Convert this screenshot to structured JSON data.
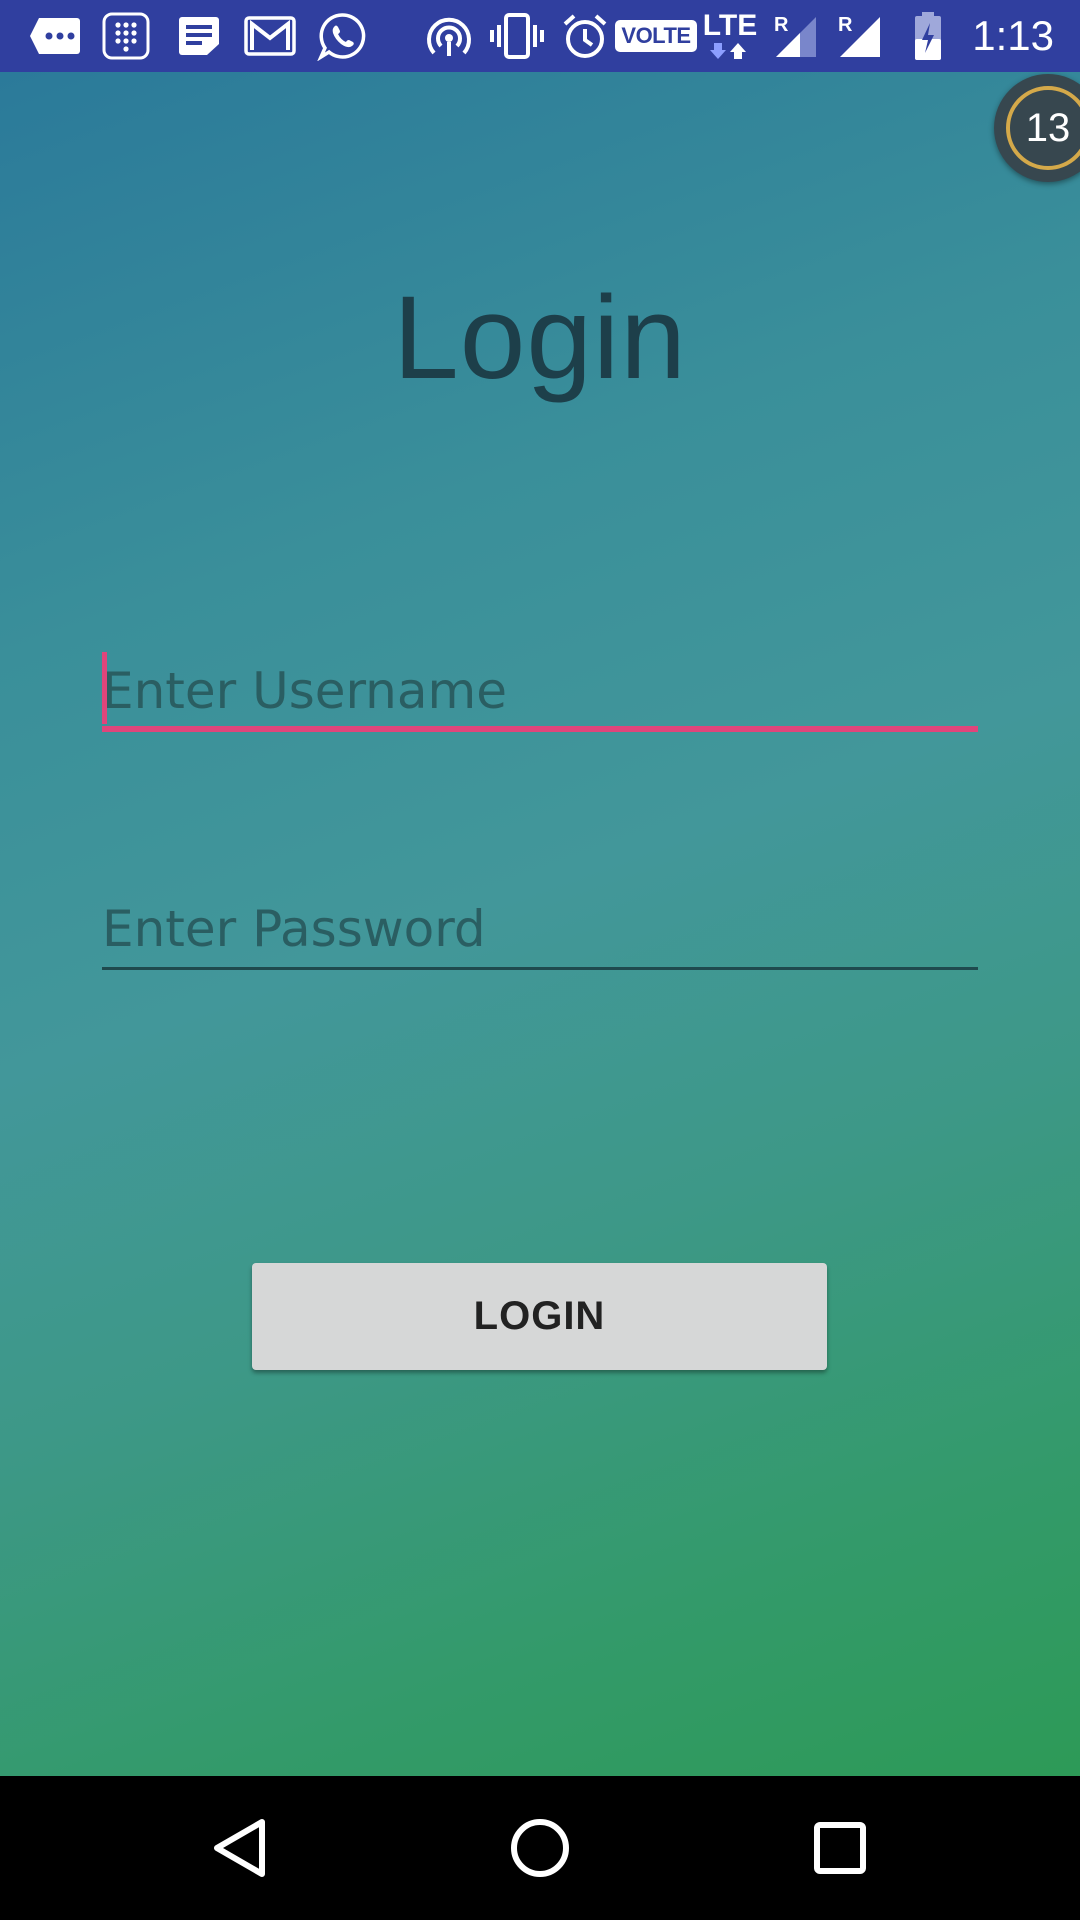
{
  "status_bar": {
    "time": "1:13",
    "network_badge": "VOLTE",
    "network_type": "LTE",
    "roaming_1": "R",
    "roaming_2": "R",
    "icons": [
      "message-more-icon",
      "dialpad-icon",
      "notes-icon",
      "gmail-icon",
      "whatsapp-icon",
      "hotspot-icon",
      "vibrate-icon",
      "alarm-icon",
      "volte-icon",
      "lte-icon",
      "signal-icon",
      "signal-icon",
      "battery-charging-icon"
    ]
  },
  "floating_badge": {
    "count": "13"
  },
  "login": {
    "title": "Login",
    "username_placeholder": "Enter Username",
    "username_value": "",
    "password_placeholder": "Enter Password",
    "password_value": "",
    "button_label": "LOGIN"
  },
  "nav_bar": {
    "icons": [
      "back-icon",
      "home-icon",
      "recents-icon"
    ]
  },
  "colors": {
    "status_bar": "#303f9f",
    "accent": "#e0457b",
    "button": "#d6d7d7",
    "title_text": "#1d3f4a"
  }
}
